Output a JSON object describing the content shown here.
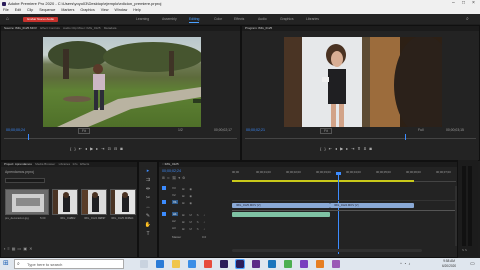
{
  "window": {
    "title": "Adobe Premiere Pro 2020 - C:\\Users\\yoyo03\\Desktop\\ejemplo\\edicion_premiere.prproj"
  },
  "menu": [
    "File",
    "Edit",
    "Clip",
    "Sequence",
    "Markers",
    "Graphics",
    "View",
    "Window",
    "Help"
  ],
  "workspace": {
    "record_label": "Grabar Nuevo Audio",
    "tabs": [
      "Learning",
      "Assembly",
      "Editing",
      "Color",
      "Effects",
      "Audio",
      "Graphics",
      "Libraries"
    ],
    "active": 2
  },
  "source": {
    "tabs": [
      "Source: IMG_0125.MOV",
      "Effect Controls",
      "Audio Clip Mixer: IMG_0125",
      "Metadata"
    ],
    "timecode": "00;00;00;24",
    "fit": "Fit",
    "fraction": "1/2",
    "duration": "00;00;02;17"
  },
  "program": {
    "tabs": [
      "Program: IMG_0125"
    ],
    "timecode": "00;00;02;21",
    "fit": "Fit",
    "fraction": "Full",
    "duration": "00;00;03;15"
  },
  "project": {
    "tabs": [
      "Project: Aprendamos",
      "Media Browser",
      "Libraries",
      "Info",
      "Effects"
    ],
    "name": "Aprendamos.prproj",
    "items": [
      {
        "name": "pre_decoracion.jpg",
        "dur": "5:00"
      },
      {
        "name": "IMG_0125",
        "dur": "3:22"
      },
      {
        "name": "IMG_0124.MOV",
        "dur": "2:17"
      },
      {
        "name": "IMG_0125.MOV",
        "dur": "3:14"
      }
    ]
  },
  "timeline": {
    "tab": "IMG_0125",
    "timecode": "00;00;02;24",
    "ruler": [
      "00;00",
      "00;00;01;00",
      "00;00;02;00",
      "00;00;03;00",
      "00;00;04;00",
      "00;00;05;00",
      "00;00;06;00",
      "00;00;07;00"
    ],
    "tracks": [
      "V3",
      "V2",
      "V1",
      "A1",
      "A2",
      "A3",
      "Master"
    ],
    "master_level": "0.0",
    "clip_v1a": "IMG_0125.MOV [V]",
    "clip_v1b": "IMG_0124.MOV [V]"
  },
  "taskbar": {
    "search_placeholder": "Type here to search",
    "time": "9:58 AM",
    "date": "6/20/2020"
  }
}
